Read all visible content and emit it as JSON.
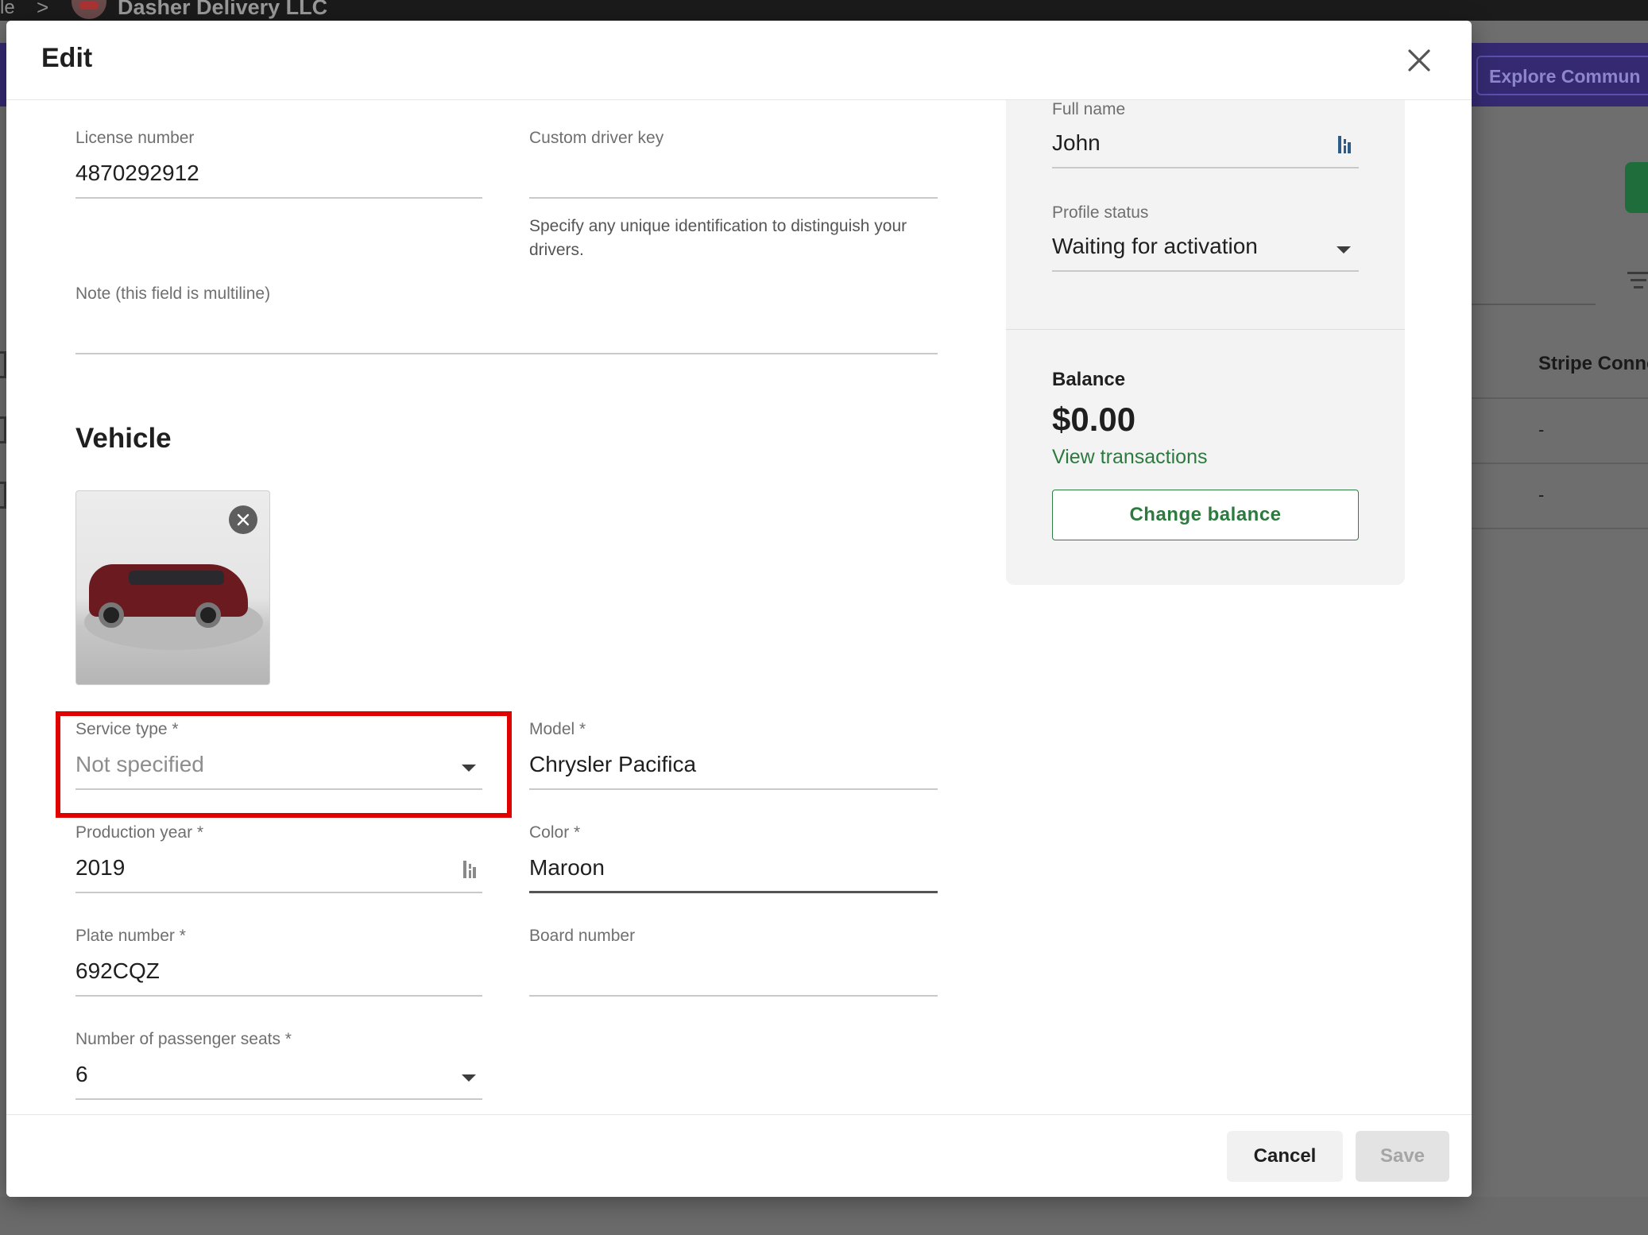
{
  "background": {
    "breadcrumb_prefix": "le",
    "breadcrumb_separator": ">",
    "company_name": "Dasher Delivery LLC",
    "explore_button": "Explore Commun",
    "table_header": "Stripe Conne",
    "row1_value": "-",
    "row2_value": "-"
  },
  "modal": {
    "title": "Edit",
    "close_icon": "close-icon",
    "driver": {
      "license_label": "License number",
      "license_value": "4870292912",
      "custom_key_label": "Custom driver key",
      "custom_key_value": "",
      "custom_key_hint": "Specify any unique identification to distinguish your drivers.",
      "note_label": "Note (this field is multiline)",
      "note_value": ""
    },
    "vehicle": {
      "section_title": "Vehicle",
      "service_type_label": "Service type *",
      "service_type_value": "Not specified",
      "model_label": "Model *",
      "model_value": "Chrysler Pacifica",
      "production_year_label": "Production year *",
      "production_year_value": "2019",
      "color_label": "Color *",
      "color_value": "Maroon",
      "plate_label": "Plate number *",
      "plate_value": "692CQZ",
      "board_label": "Board number",
      "board_value": "",
      "seats_label": "Number of passenger seats *",
      "seats_value": "6"
    },
    "profile": {
      "full_name_label": "Full name",
      "full_name_value": "John",
      "status_label": "Profile status",
      "status_value": "Waiting for activation"
    },
    "balance": {
      "label": "Balance",
      "value": "$0.00",
      "view_transactions": "View transactions",
      "change_balance": "Change balance"
    },
    "footer": {
      "cancel": "Cancel",
      "save": "Save"
    }
  },
  "colors": {
    "accent_green": "#2c7a3e",
    "highlight_red": "#e10000",
    "purple_bar": "#352a72"
  }
}
